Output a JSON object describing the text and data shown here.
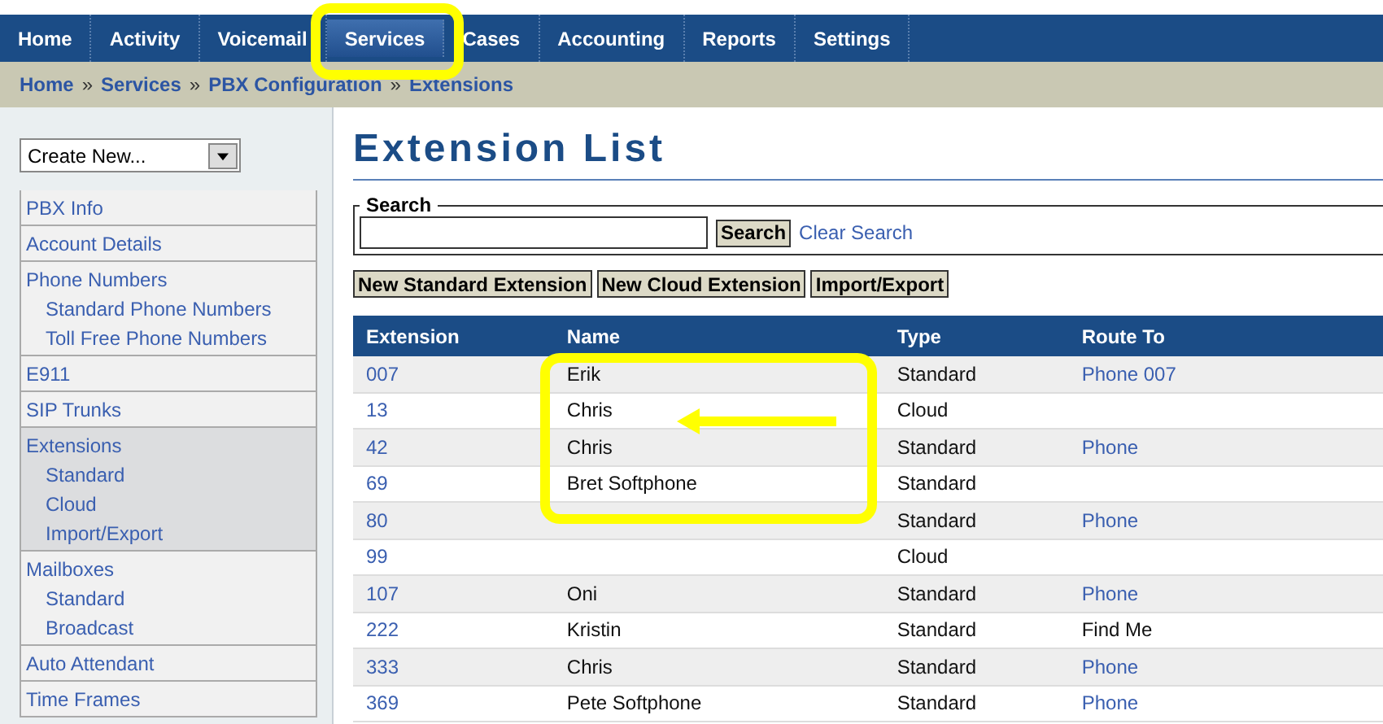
{
  "nav": [
    {
      "label": "Home",
      "selected": false
    },
    {
      "label": "Activity",
      "selected": false
    },
    {
      "label": "Voicemail",
      "selected": false
    },
    {
      "label": "Services",
      "selected": true
    },
    {
      "label": "Cases",
      "selected": false
    },
    {
      "label": "Accounting",
      "selected": false
    },
    {
      "label": "Reports",
      "selected": false
    },
    {
      "label": "Settings",
      "selected": false
    }
  ],
  "breadcrumb": [
    "Home",
    "Services",
    "PBX Configuration",
    "Extensions"
  ],
  "breadcrumb_separator": "»",
  "create_select": {
    "value": "Create New..."
  },
  "sidebar": [
    {
      "label": "PBX Info",
      "selected": false
    },
    {
      "label": "Account Details",
      "selected": false
    },
    {
      "label": "Phone Numbers",
      "selected": false,
      "children": [
        "Standard Phone Numbers",
        "Toll Free Phone Numbers"
      ]
    },
    {
      "label": "E911",
      "selected": false
    },
    {
      "label": "SIP Trunks",
      "selected": false
    },
    {
      "label": "Extensions",
      "selected": true,
      "children": [
        "Standard",
        "Cloud",
        "Import/Export"
      ]
    },
    {
      "label": "Mailboxes",
      "selected": false,
      "children": [
        "Standard",
        "Broadcast"
      ]
    },
    {
      "label": "Auto Attendant",
      "selected": false
    },
    {
      "label": "Time Frames",
      "selected": false
    }
  ],
  "title": "Extension List",
  "search": {
    "legend": "Search",
    "button": "Search",
    "clear": "Clear Search"
  },
  "actions": [
    "New Standard Extension",
    "New Cloud Extension",
    "Import/Export"
  ],
  "table": {
    "columns": [
      "Extension",
      "Name",
      "Type",
      "Route To"
    ],
    "rows": [
      {
        "extension": "007",
        "name": "Erik",
        "type": "Standard",
        "route": "Phone 007",
        "route_link": true
      },
      {
        "extension": "13",
        "name": "Chris",
        "type": "Cloud"
      },
      {
        "extension": "42",
        "name": "Chris",
        "type": "Standard",
        "route": "Phone",
        "route_link": true
      },
      {
        "extension": "69",
        "name": "Bret Softphone",
        "type": "Standard"
      },
      {
        "extension": "80",
        "type": "Standard",
        "route": "Phone",
        "route_link": true
      },
      {
        "extension": "99",
        "type": "Cloud"
      },
      {
        "extension": "107",
        "name": "Oni",
        "type": "Standard",
        "route": "Phone",
        "route_link": true
      },
      {
        "extension": "222",
        "name": "Kristin",
        "type": "Standard",
        "route": "Find Me",
        "route_link": false
      },
      {
        "extension": "333",
        "name": "Chris",
        "type": "Standard",
        "route": "Phone",
        "route_link": true
      },
      {
        "extension": "369",
        "name": "Pete Softphone",
        "type": "Standard",
        "route": "Phone",
        "route_link": true
      }
    ]
  }
}
